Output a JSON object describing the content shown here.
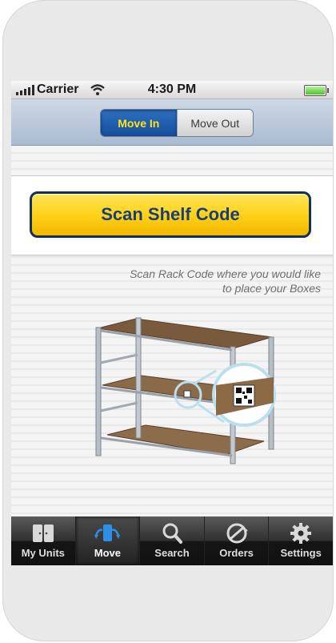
{
  "status_bar": {
    "carrier": "Carrier",
    "time": "4:30 PM"
  },
  "segmented_control": {
    "options": [
      "Move In",
      "Move Out"
    ],
    "selected": "Move In"
  },
  "scan_button": {
    "label": "Scan Shelf Code"
  },
  "instruction": {
    "line1": "Scan Rack Code where you would like",
    "line2": "to place your Boxes"
  },
  "tab_bar": {
    "items": [
      {
        "label": "My Units",
        "icon": "units-icon"
      },
      {
        "label": "Move",
        "icon": "move-icon"
      },
      {
        "label": "Search",
        "icon": "search-icon"
      },
      {
        "label": "Orders",
        "icon": "orders-icon"
      },
      {
        "label": "Settings",
        "icon": "gear-icon"
      }
    ],
    "selected": "Move"
  },
  "colors": {
    "accent_blue": "#1a55a3",
    "button_yellow": "#ffd21a",
    "button_text": "#173e78",
    "segment_active_text": "#ffe21a"
  }
}
